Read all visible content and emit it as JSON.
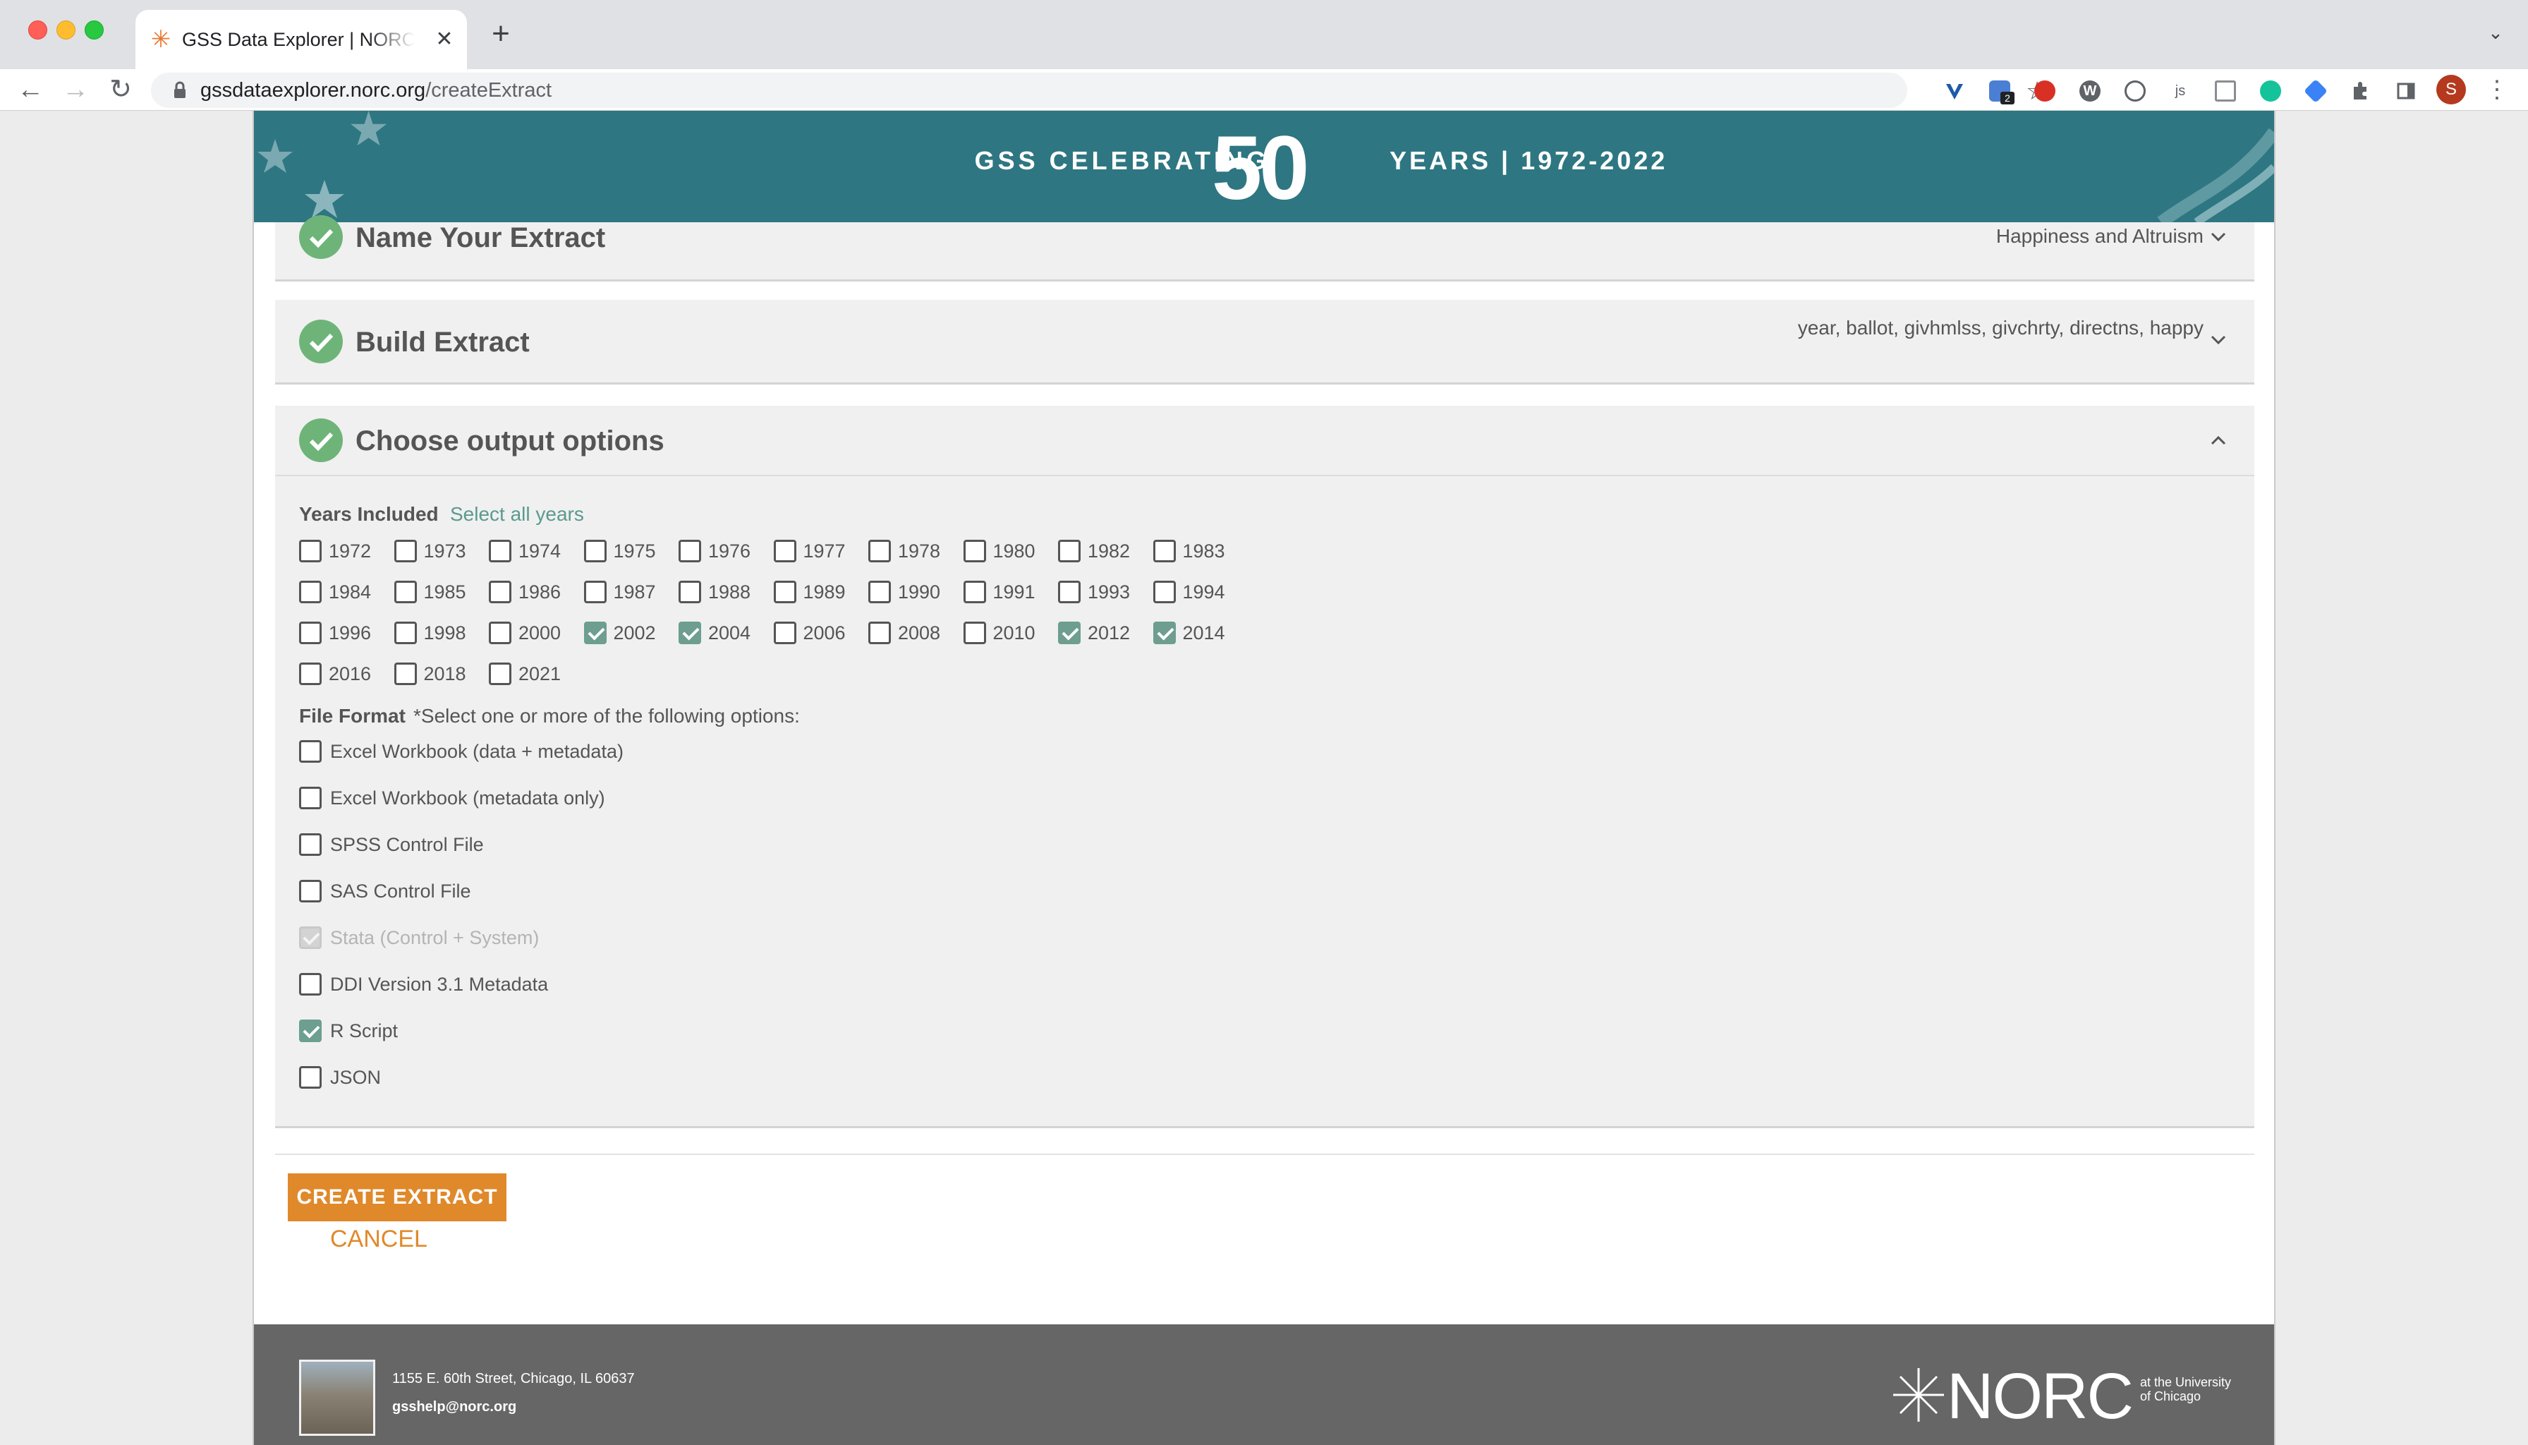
{
  "browser": {
    "tab_title": "GSS Data Explorer | NORC at the University of Chicago",
    "tab_close": "✕",
    "new_tab": "+",
    "url_host": "gssdataexplorer.norc.org",
    "url_path": "/createExtract",
    "profile_initial": "S",
    "extension_badge": "2",
    "extension_js_label": "js"
  },
  "banner": {
    "left_text": "GSS CELEBRATING",
    "big_number": "50",
    "right_text": "YEARS | 1972-2022"
  },
  "sections": {
    "name": {
      "title": "Name Your Extract",
      "summary": "Happiness and Altruism"
    },
    "build": {
      "title": "Build Extract",
      "summary": "year, ballot, givhmlss, givchrty, directns, happy"
    },
    "output": {
      "title": "Choose output options"
    }
  },
  "years": {
    "label": "Years Included",
    "select_all": "Select all years",
    "items": [
      {
        "year": "1972",
        "checked": false
      },
      {
        "year": "1973",
        "checked": false
      },
      {
        "year": "1974",
        "checked": false
      },
      {
        "year": "1975",
        "checked": false
      },
      {
        "year": "1976",
        "checked": false
      },
      {
        "year": "1977",
        "checked": false
      },
      {
        "year": "1978",
        "checked": false
      },
      {
        "year": "1980",
        "checked": false
      },
      {
        "year": "1982",
        "checked": false
      },
      {
        "year": "1983",
        "checked": false
      },
      {
        "year": "1984",
        "checked": false
      },
      {
        "year": "1985",
        "checked": false
      },
      {
        "year": "1986",
        "checked": false
      },
      {
        "year": "1987",
        "checked": false
      },
      {
        "year": "1988",
        "checked": false
      },
      {
        "year": "1989",
        "checked": false
      },
      {
        "year": "1990",
        "checked": false
      },
      {
        "year": "1991",
        "checked": false
      },
      {
        "year": "1993",
        "checked": false
      },
      {
        "year": "1994",
        "checked": false
      },
      {
        "year": "1996",
        "checked": false
      },
      {
        "year": "1998",
        "checked": false
      },
      {
        "year": "2000",
        "checked": false
      },
      {
        "year": "2002",
        "checked": true
      },
      {
        "year": "2004",
        "checked": true
      },
      {
        "year": "2006",
        "checked": false
      },
      {
        "year": "2008",
        "checked": false
      },
      {
        "year": "2010",
        "checked": false
      },
      {
        "year": "2012",
        "checked": true
      },
      {
        "year": "2014",
        "checked": true
      },
      {
        "year": "2016",
        "checked": false
      },
      {
        "year": "2018",
        "checked": false
      },
      {
        "year": "2021",
        "checked": false
      }
    ]
  },
  "file_format": {
    "label": "File Format",
    "hint": "*Select one or more of the following options:",
    "options": [
      {
        "label": "Excel Workbook (data + metadata)",
        "checked": false,
        "disabled": false
      },
      {
        "label": "Excel Workbook (metadata only)",
        "checked": false,
        "disabled": false
      },
      {
        "label": "SPSS Control File",
        "checked": false,
        "disabled": false
      },
      {
        "label": "SAS Control File",
        "checked": false,
        "disabled": false
      },
      {
        "label": "Stata (Control + System)",
        "checked": true,
        "disabled": true
      },
      {
        "label": "DDI Version 3.1 Metadata",
        "checked": false,
        "disabled": false
      },
      {
        "label": "R Script",
        "checked": true,
        "disabled": false
      },
      {
        "label": "JSON",
        "checked": false,
        "disabled": false
      }
    ]
  },
  "actions": {
    "create": "CREATE EXTRACT",
    "cancel": "CANCEL"
  },
  "footer": {
    "address": "1155 E. 60th Street, Chicago, IL 60637",
    "email": "gsshelp@norc.org",
    "logo_text": "NORC",
    "logo_sub": "at the University of Chicago"
  },
  "colors": {
    "banner": "#2e7682",
    "check_green": "#6eb479",
    "checkbox_checked": "#6d9e8f",
    "accent_orange": "#e0892b",
    "footer": "#666666"
  }
}
